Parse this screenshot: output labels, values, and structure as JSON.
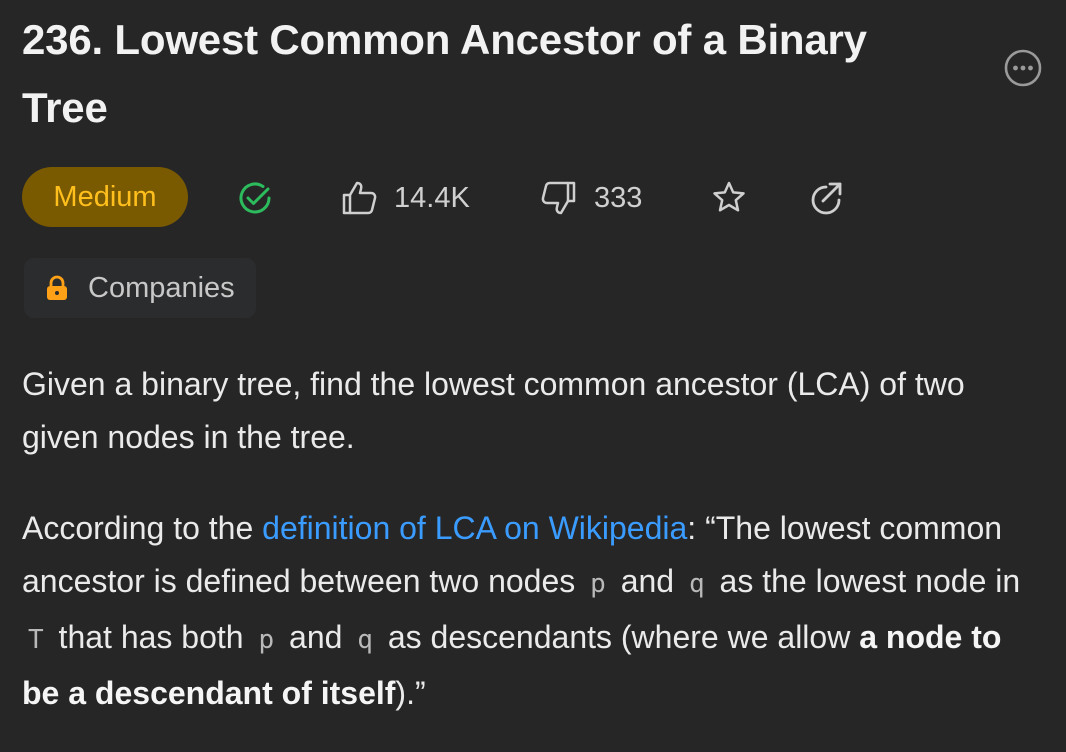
{
  "problem": {
    "title": "236. Lowest Common Ancestor of a Binary Tree",
    "difficulty": "Medium",
    "likes": "14.4K",
    "dislikes": "333",
    "companies_label": "Companies"
  },
  "description": {
    "p1": "Given a binary tree, find the lowest common ancestor (LCA) of two given nodes in the tree.",
    "p2": {
      "t1": "According to the ",
      "link": "definition of LCA on Wikipedia",
      "t2": ": “The lowest common ancestor is defined between two nodes ",
      "code_p1": "p",
      "t3": " and ",
      "code_q1": "q",
      "t4": " as the lowest node in ",
      "code_T": "T",
      "t5": " that has both ",
      "code_p2": "p",
      "t6": " and ",
      "code_q2": "q",
      "t7": " as descendants (where we allow ",
      "bold": "a node to be a descendant of itself",
      "t8": ").”"
    }
  },
  "colors": {
    "background": "#262626",
    "badge_bg": "#7a5a00",
    "badge_text": "#ffc01e",
    "solved_check": "#2cbb5d",
    "link": "#3b9cff",
    "lock": "#ffa116"
  },
  "icons": {
    "more": "more-horizontal-icon",
    "solved": "check-circle-icon",
    "like": "thumbs-up-icon",
    "dislike": "thumbs-down-icon",
    "favorite": "star-icon",
    "share": "share-icon",
    "lock": "lock-icon"
  }
}
